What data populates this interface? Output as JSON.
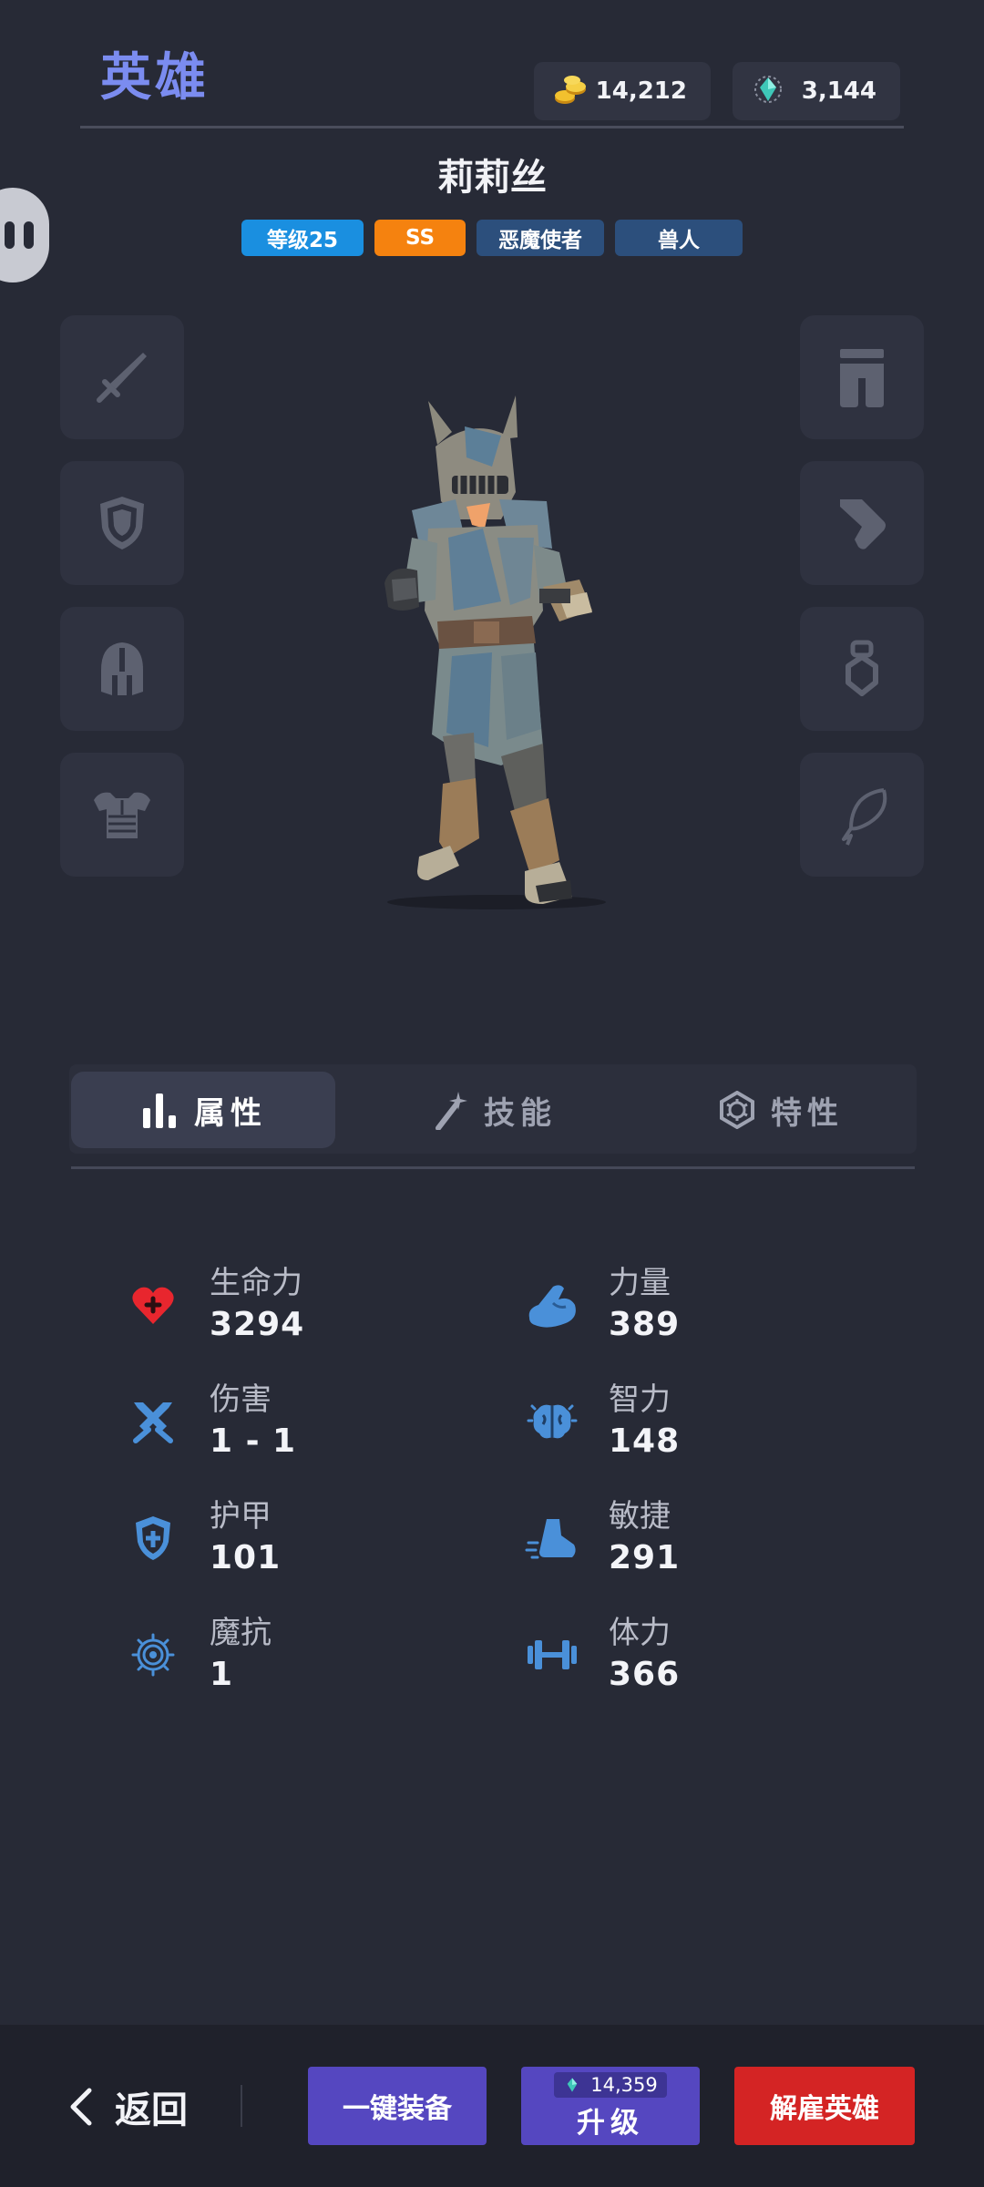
{
  "header": {
    "title": "英雄",
    "gold": "14,212",
    "gems": "3,144"
  },
  "hero": {
    "name": "莉莉丝",
    "tags": {
      "level": "等级25",
      "rank": "SS",
      "class": "恶魔使者",
      "race": "兽人"
    }
  },
  "equipment_slots": {
    "left": [
      "sword-icon",
      "shield-icon",
      "helmet-icon",
      "chest-armor-icon"
    ],
    "right": [
      "pants-icon",
      "boots-icon",
      "ring-icon",
      "necklace-icon"
    ]
  },
  "tabs": [
    {
      "label": "属性",
      "active": true
    },
    {
      "label": "技能",
      "active": false
    },
    {
      "label": "特性",
      "active": false
    }
  ],
  "stats": {
    "hp": {
      "label": "生命力",
      "value": "3294"
    },
    "strength": {
      "label": "力量",
      "value": "389"
    },
    "damage": {
      "label": "伤害",
      "value": "1 - 1"
    },
    "intellect": {
      "label": "智力",
      "value": "148"
    },
    "armor": {
      "label": "护甲",
      "value": "101"
    },
    "agility": {
      "label": "敏捷",
      "value": "291"
    },
    "magic_res": {
      "label": "魔抗",
      "value": "1"
    },
    "stamina": {
      "label": "体力",
      "value": "366"
    }
  },
  "bottom": {
    "back_label": "返回",
    "equip_label": "一键装备",
    "upgrade_cost": "14,359",
    "upgrade_label": "升级",
    "dismiss_label": "解雇英雄"
  },
  "colors": {
    "background": "#272a36",
    "title_accent": "#7b8cf0",
    "level_tag": "#1a8fe0",
    "rank_tag": "#f5820f",
    "class_tag": "#2c4f7c",
    "button_purple": "#5547c0",
    "button_red": "#d42424",
    "stat_icon_blue": "#4a90d9",
    "hp_icon_red": "#e8262e"
  }
}
